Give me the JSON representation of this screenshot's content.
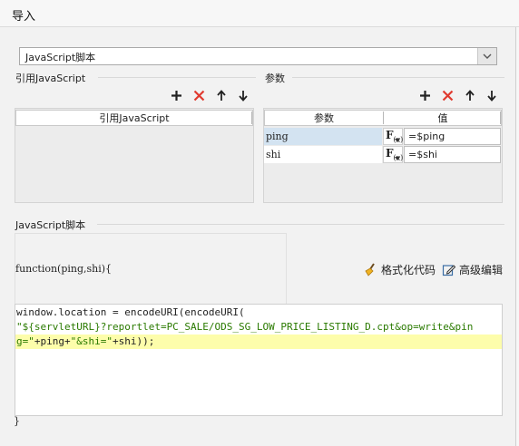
{
  "window": {
    "title": "导入"
  },
  "script_type": {
    "selected": "JavaScript脚本"
  },
  "ref_section": {
    "label": "引用JavaScript",
    "column_header": "引用JavaScript"
  },
  "params_section": {
    "label": "参数",
    "col_param": "参数",
    "col_value": "值",
    "rows": [
      {
        "name": "ping",
        "value": "=$ping"
      },
      {
        "name": "shi",
        "value": "=$shi"
      }
    ]
  },
  "toolbar_icons": [
    "plus-icon",
    "delete-x-icon",
    "arrow-up-icon",
    "arrow-down-icon"
  ],
  "script_section": {
    "label": "JavaScript脚本",
    "function_header": "function(ping,shi){",
    "format_label": "格式化代码",
    "advanced_label": "高级编辑",
    "code_line1": "window.location = encodeURI(encodeURI(",
    "code_line2": "\"${servletURL}?reportlet=PC_SALE/ODS_SG_LOW_PRICE_LISTING_D.cpt&op=write&pin",
    "code_line3_str1": "g=\"",
    "code_line3_mid1": "+ping+",
    "code_line3_str2": "\"&shi=\"",
    "code_line3_end": "+shi));",
    "closing_brace": "}"
  },
  "colors": {
    "accent_red": "#e03a2f",
    "selected_cell": "#d3e3f1",
    "highlight_line": "#fdfdab",
    "string_green": "#2a7a00"
  }
}
